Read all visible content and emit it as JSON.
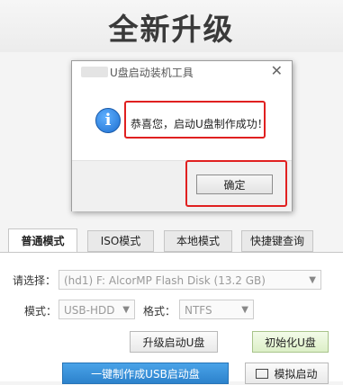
{
  "banner": {
    "title": "全新升级"
  },
  "dialog": {
    "title": "U盘启动装机工具",
    "close_glyph": "✕",
    "info_glyph": "i",
    "message": "恭喜您，启动U盘制作成功！",
    "ok_label": "确定"
  },
  "tabs": [
    {
      "label": "普通模式",
      "active": true
    },
    {
      "label": "ISO模式",
      "active": false
    },
    {
      "label": "本地模式",
      "active": false
    },
    {
      "label": "快捷键查询",
      "active": false
    }
  ],
  "form": {
    "device_label": "请选择：",
    "device_value": "(hd1) F: AlcorMP Flash Disk (13.2 GB)",
    "mode_label": "模式：",
    "mode_value": "USB-HDD",
    "format_label": "格式：",
    "format_value": "NTFS",
    "dropdown_glyph": "▼"
  },
  "buttons": {
    "upgrade": "升级启动U盘",
    "init": "初始化U盘",
    "make": "一键制作成USB启动盘",
    "simulate": "模拟启动"
  },
  "colors": {
    "highlight": "#e02020",
    "info_blue": "#1e6fd0",
    "make_button": "#2c82cc"
  }
}
